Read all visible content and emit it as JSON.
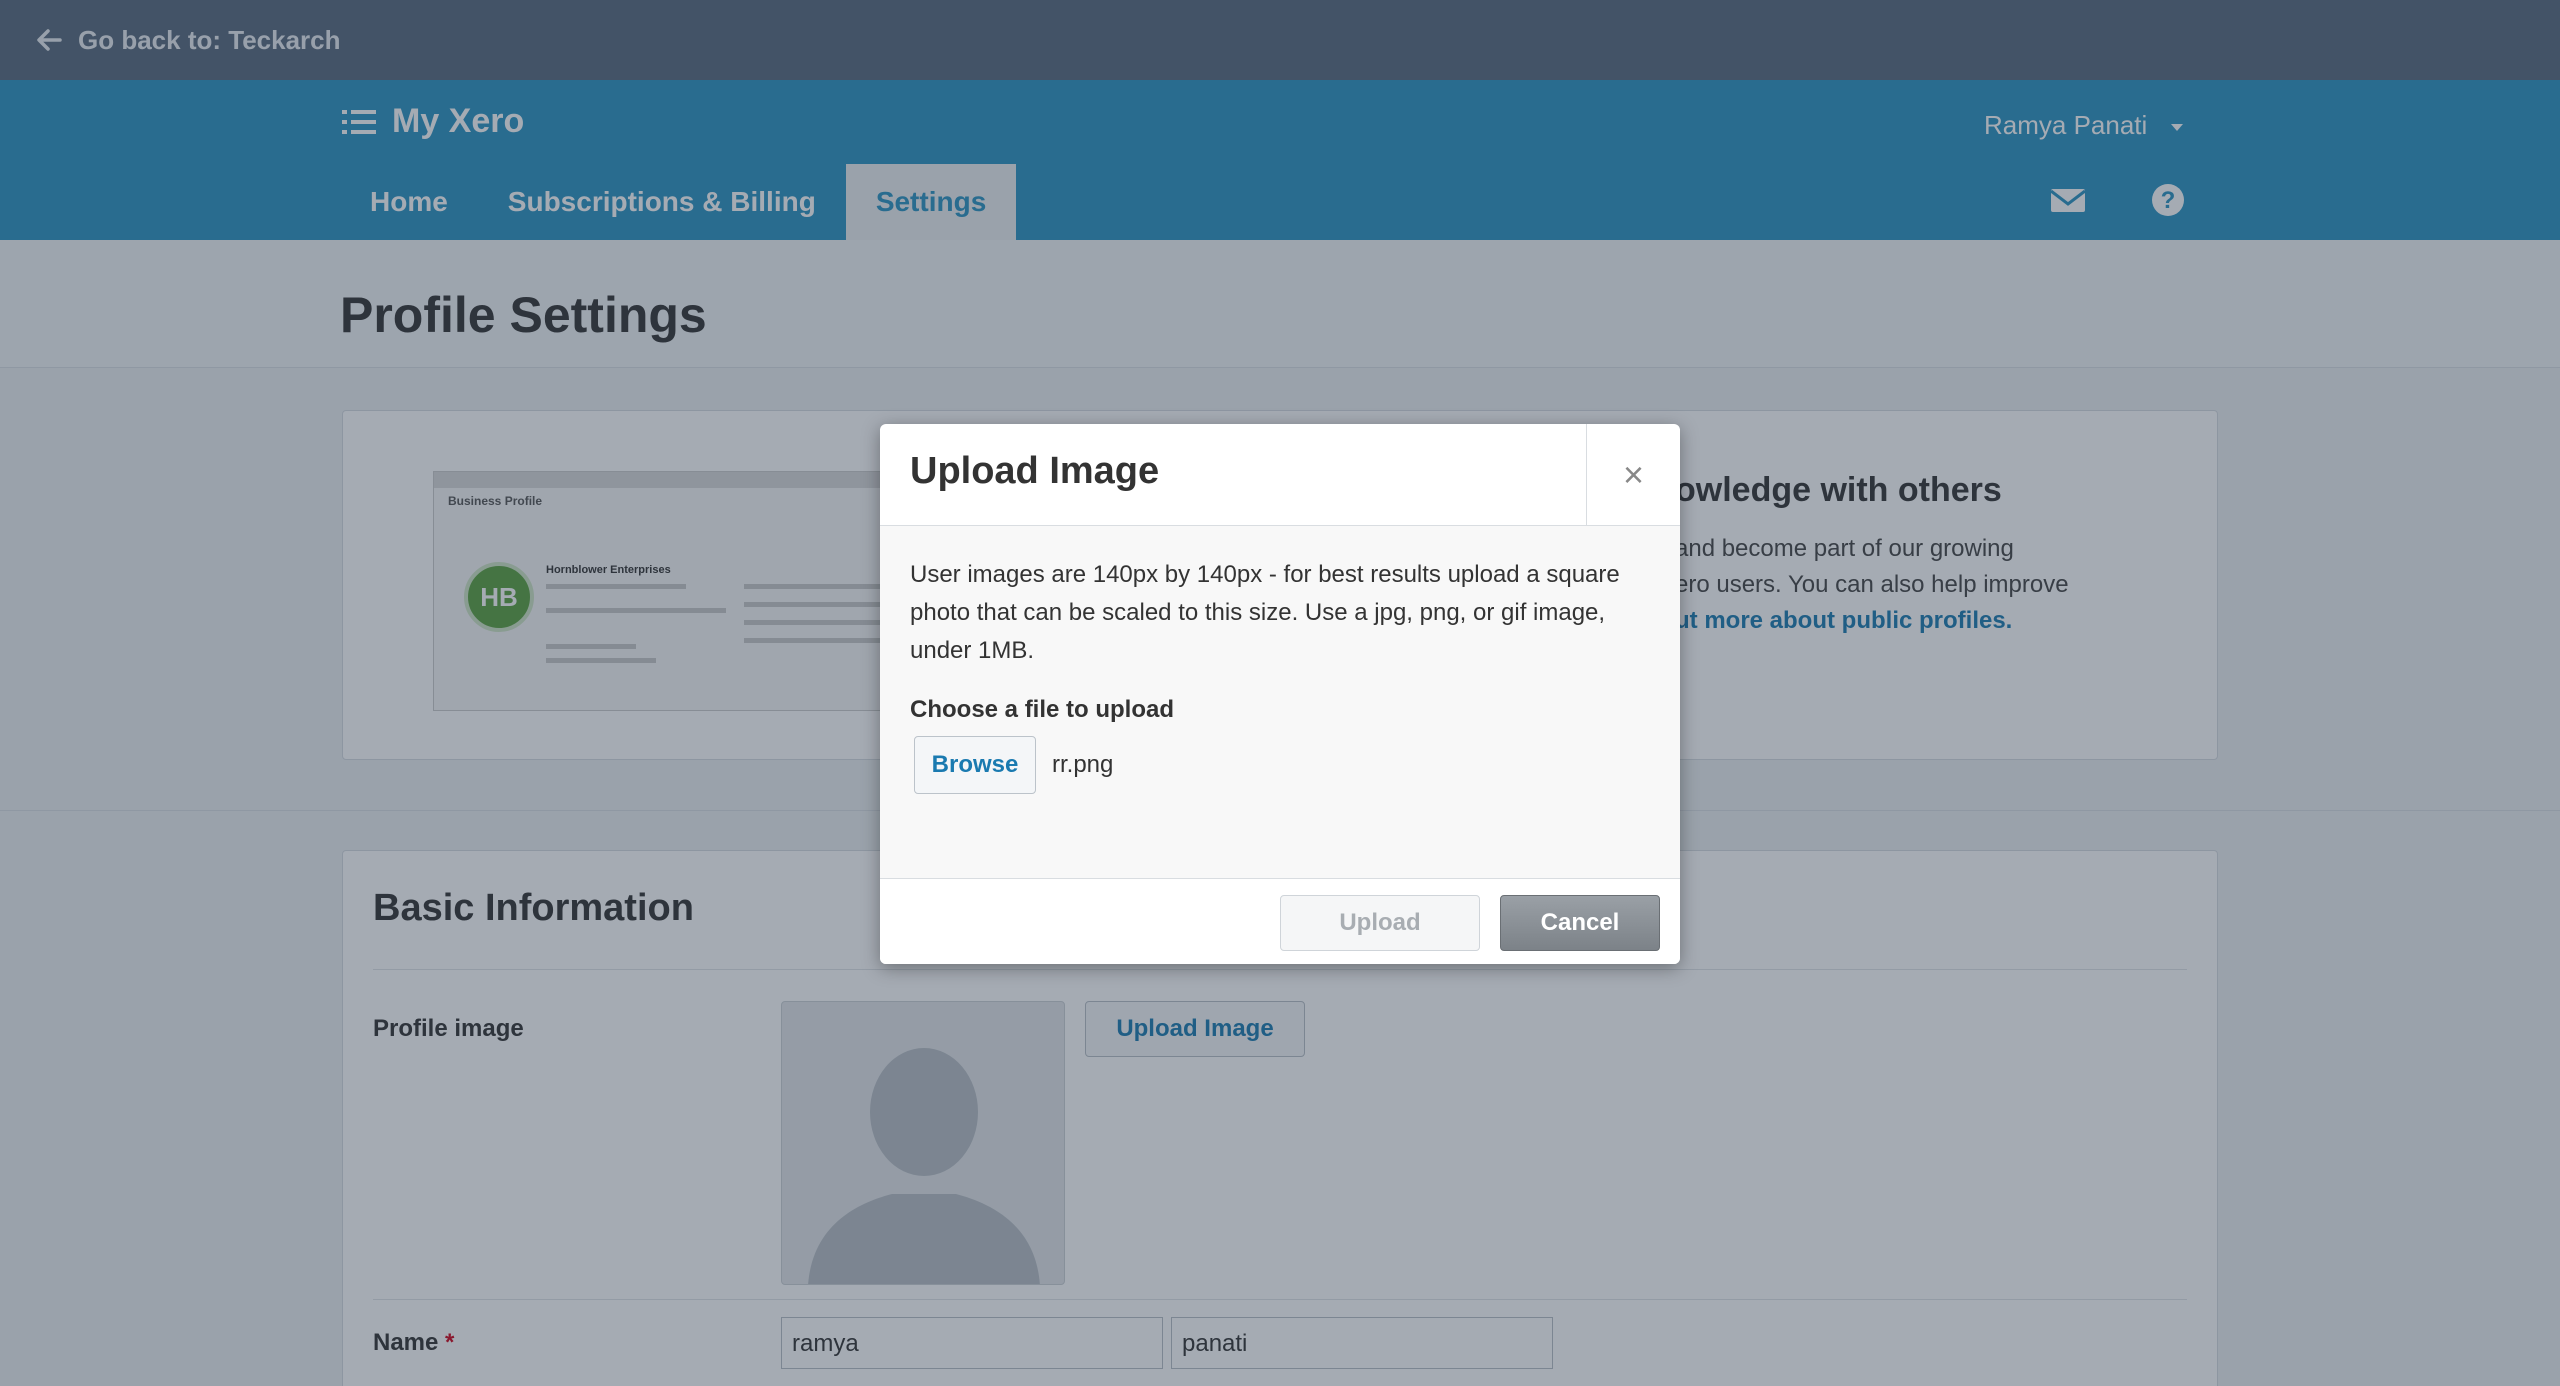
{
  "backbar": {
    "label": "Go back to: Teckarch"
  },
  "header": {
    "brand": "My Xero",
    "user": "Ramya Panati",
    "tabs": [
      {
        "label": "Home",
        "active": false
      },
      {
        "label": "Subscriptions & Billing",
        "active": false
      },
      {
        "label": "Settings",
        "active": true
      }
    ]
  },
  "page": {
    "title": "Profile Settings"
  },
  "promo": {
    "heading": "owledge with others",
    "line1": "and become part of our growing",
    "line2": "ero users. You can also help improve",
    "link": "ut more about public profiles.",
    "thumb_title": "Business Profile",
    "thumb_logo": "HB",
    "thumb_company": "Hornblower Enterprises"
  },
  "basic": {
    "title": "Basic Information",
    "profile_image_label": "Profile image",
    "upload_image_button": "Upload Image",
    "name_label": "Name",
    "required_marker": "*",
    "first_name": "ramya",
    "last_name": "panati"
  },
  "modal": {
    "title": "Upload Image",
    "close_glyph": "×",
    "description": "User images are 140px by 140px - for best results upload a square photo that can be scaled to this size. Use a jpg, png, or gif image, under 1MB.",
    "choose_label": "Choose a file to upload",
    "browse_label": "Browse",
    "filename": "rr.png",
    "upload_label": "Upload",
    "cancel_label": "Cancel"
  },
  "colors": {
    "header_blue": "#2a93c2",
    "backbar": "#56687c",
    "link_blue": "#1a7ab0"
  }
}
